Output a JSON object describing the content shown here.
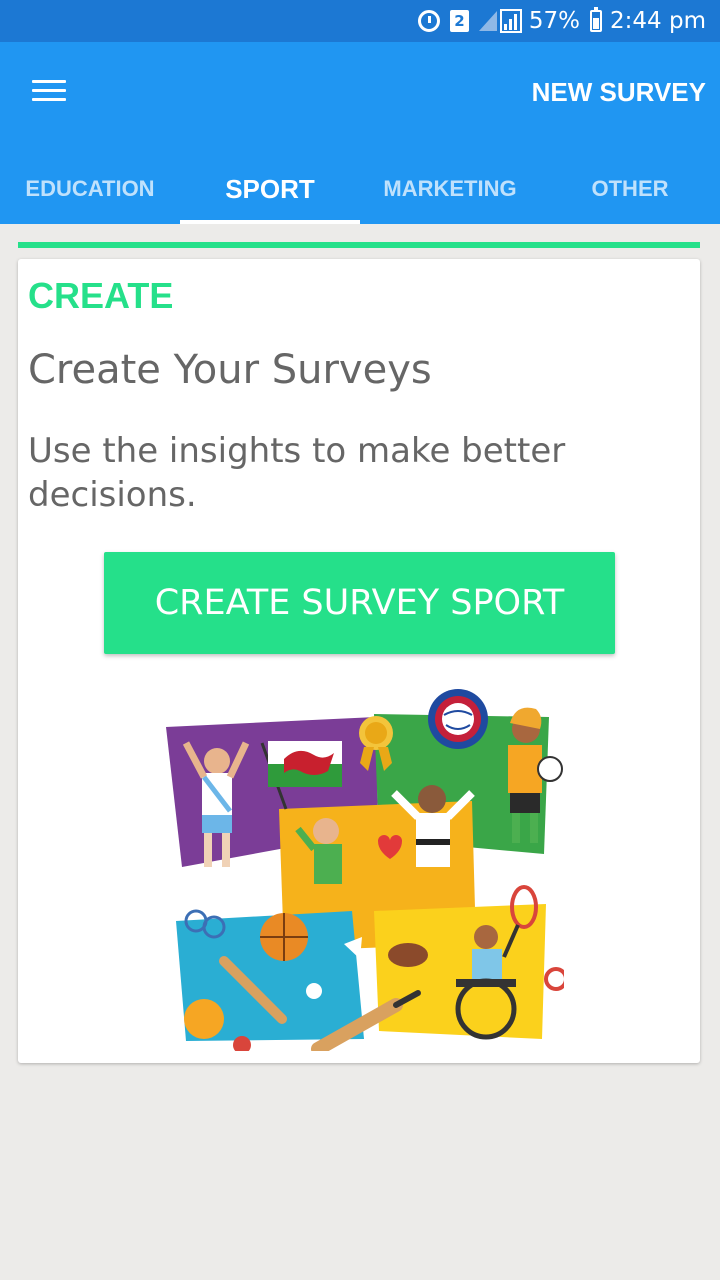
{
  "status_bar": {
    "sim_label": "2",
    "battery": "57%",
    "time": "2:44 pm",
    "icons": [
      "alarm-icon",
      "sim-icon",
      "signal-icon",
      "battery-icon"
    ]
  },
  "app_bar": {
    "menu_icon": "hamburger-menu-icon",
    "action_label": "NEW SURVEY"
  },
  "tabs": [
    {
      "label": "EDUCATION",
      "active": false
    },
    {
      "label": "SPORT",
      "active": true
    },
    {
      "label": "MARKETING",
      "active": false
    },
    {
      "label": "OTHER",
      "active": false
    }
  ],
  "card": {
    "tag": "CREATE",
    "title": "Create Your Surveys",
    "description": "Use the insights to make better decisions.",
    "button_label": "CREATE SURVEY SPORT",
    "illustration": "sports-illustration"
  },
  "colors": {
    "status_bar": "#1c78d3",
    "app_bar": "#2096f2",
    "accent_green": "#25e08a",
    "background": "#ecebe9",
    "body_text": "#666666"
  }
}
